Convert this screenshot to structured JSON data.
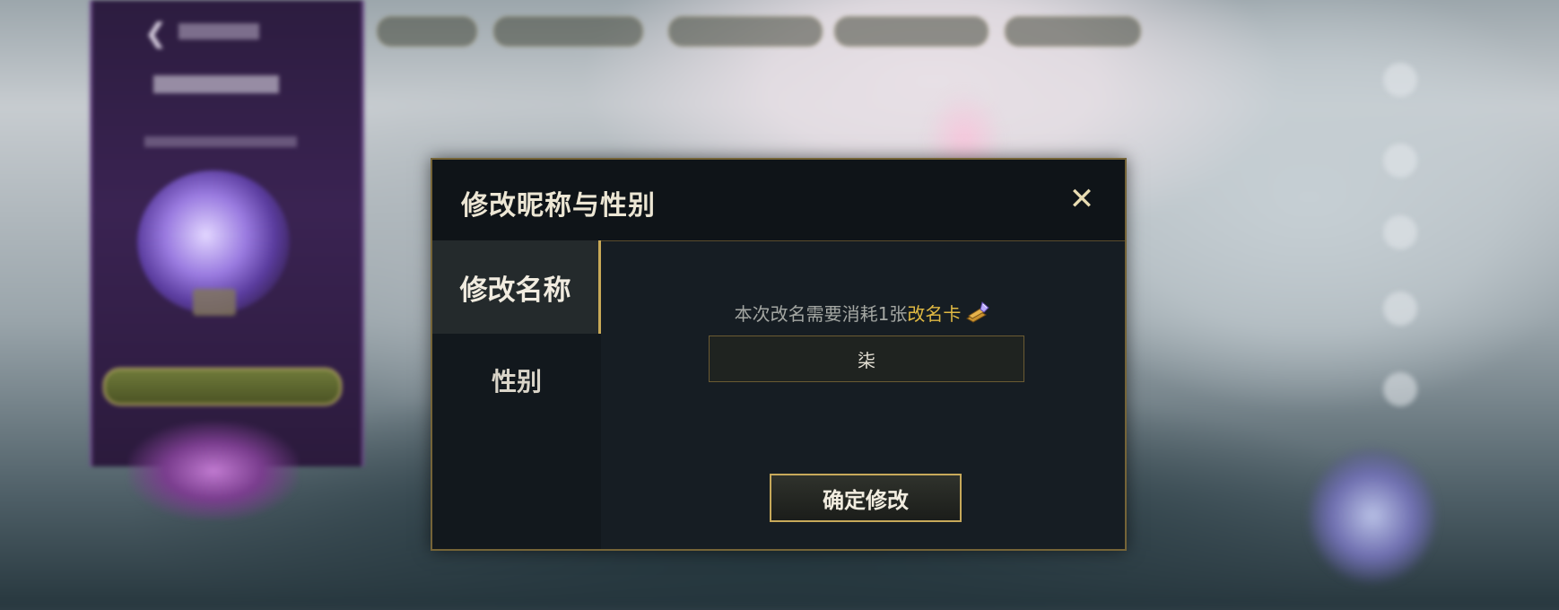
{
  "modal": {
    "title": "修改昵称与性别",
    "close_icon": "close-icon",
    "tabs": [
      {
        "label": "修改名称",
        "active": true
      },
      {
        "label": "性别",
        "active": false
      }
    ],
    "cost_text_prefix": "本次改名需要消耗1张",
    "cost_card_name": "改名卡",
    "card_icon": "rename-card-icon",
    "name_input_value": "柒",
    "confirm_label": "确定修改"
  },
  "colors": {
    "accent_gold": "#c7a95a",
    "card_name_yellow": "#e0b943",
    "modal_bg": "#161d23"
  }
}
